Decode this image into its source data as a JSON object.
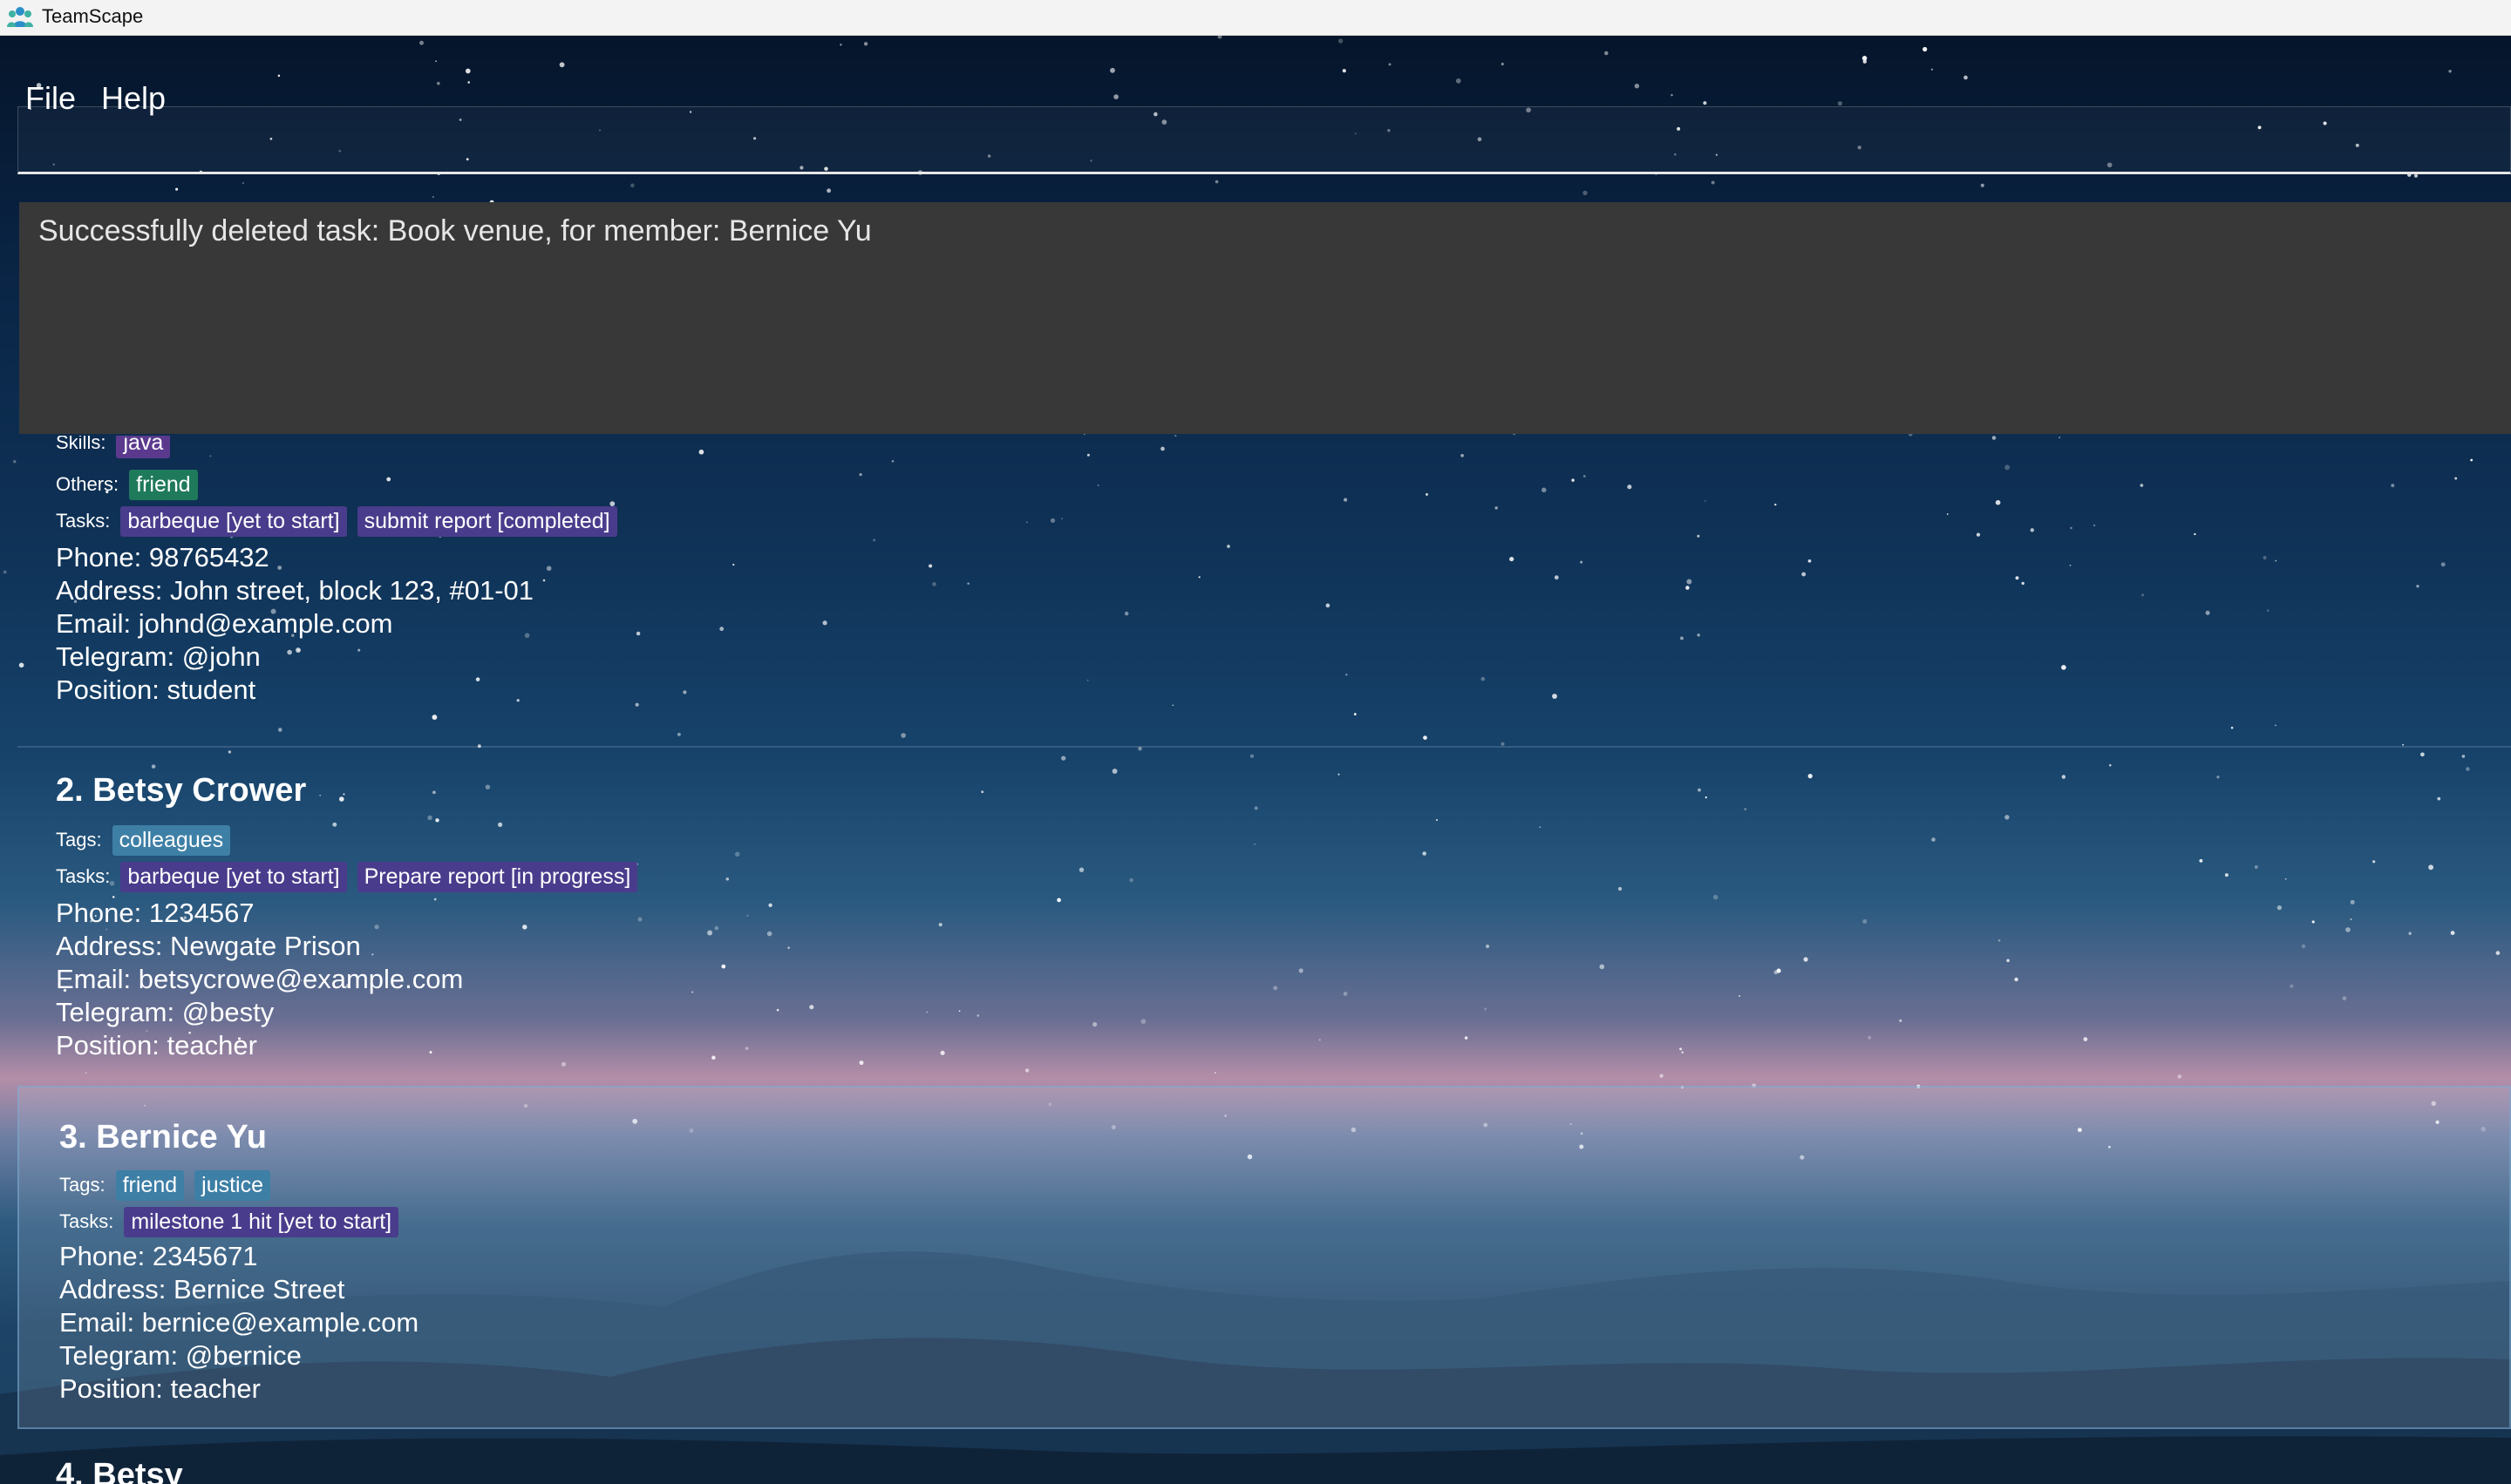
{
  "window": {
    "title": "TeamScape"
  },
  "menu": {
    "file": "File",
    "help": "Help"
  },
  "command_box": {
    "value": "",
    "placeholder": ""
  },
  "result": {
    "message": "Successfully deleted task: Book venue, for member: Bernice Yu"
  },
  "persons": [
    {
      "skills_label": "Skills:",
      "skills": [
        "java"
      ],
      "others_label": "Others:",
      "others": [
        "friend"
      ],
      "tasks_label": "Tasks:",
      "tasks": [
        "barbeque [yet to start]",
        "submit report [completed]"
      ],
      "phone": "Phone: 98765432",
      "address": "Address: John street, block 123, #01-01",
      "email": "Email: johnd@example.com",
      "telegram": "Telegram: @john",
      "position": "Position: student"
    },
    {
      "name": "2. Betsy Crower",
      "tags_label": "Tags:",
      "tags": [
        "colleagues"
      ],
      "tasks_label": "Tasks:",
      "tasks": [
        "barbeque [yet to start]",
        "Prepare report [in progress]"
      ],
      "phone": "Phone: 1234567",
      "address": "Address: Newgate Prison",
      "email": "Email: betsycrowe@example.com",
      "telegram": "Telegram: @besty",
      "position": "Position: teacher"
    },
    {
      "name": "3. Bernice Yu",
      "tags_label": "Tags:",
      "tags": [
        "friend",
        "justice"
      ],
      "tasks_label": "Tasks:",
      "tasks": [
        "milestone 1 hit [yet to start]"
      ],
      "phone": "Phone: 2345671",
      "address": "Address: Bernice Street",
      "email": "Email: bernice@example.com",
      "telegram": "Telegram: @bernice",
      "position": "Position: teacher"
    },
    {
      "name": "4. Betsy"
    }
  ],
  "colors": {
    "tag": "#3e7fa6",
    "other": "#1f7a5c",
    "skill": "#5b3a8e",
    "task": "#4a3c8c",
    "result_bg": "#383838",
    "titlebar_bg": "#f3f3f3"
  },
  "icons": {
    "app": "team-people-icon"
  }
}
